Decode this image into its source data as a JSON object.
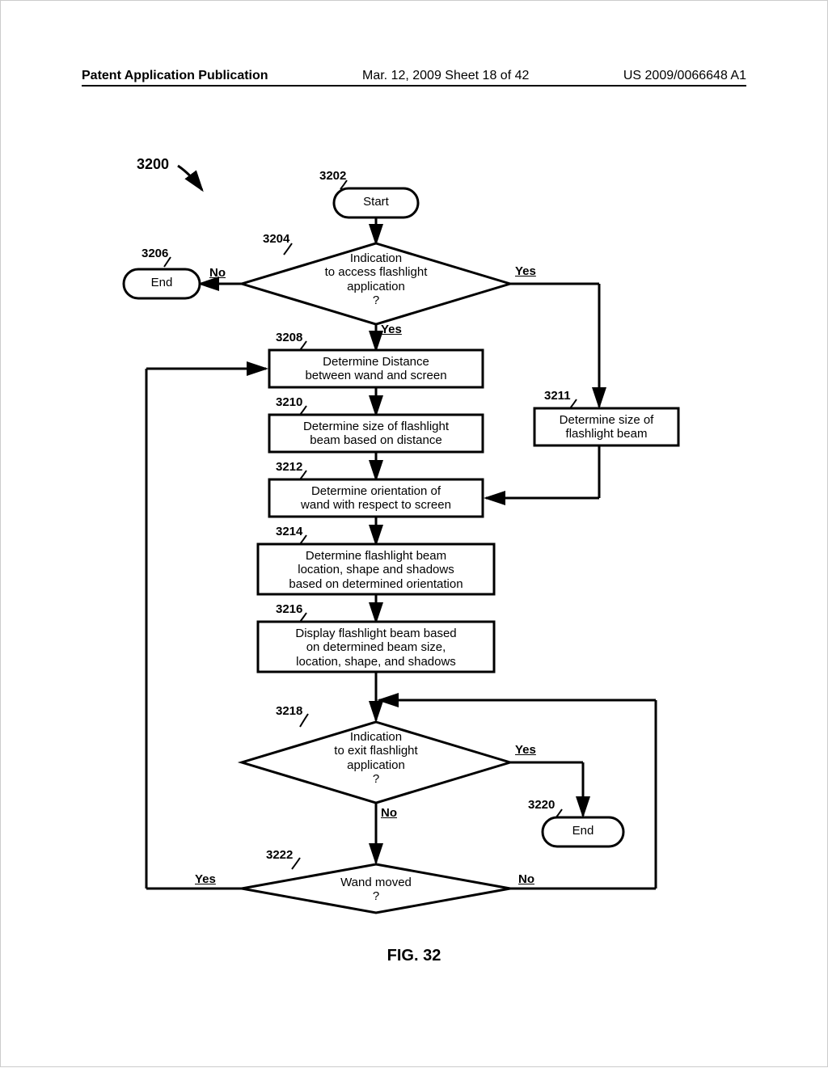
{
  "header": {
    "left": "Patent Application Publication",
    "middle": "Mar. 12, 2009  Sheet 18 of 42",
    "right": "US 2009/0066648 A1"
  },
  "figure": {
    "number_label": "3200",
    "title": "FIG. 32"
  },
  "labels": {
    "n3202": "3202",
    "n3204": "3204",
    "n3206": "3206",
    "n3208": "3208",
    "n3210": "3210",
    "n3211": "3211",
    "n3212": "3212",
    "n3214": "3214",
    "n3216": "3216",
    "n3218": "3218",
    "n3220": "3220",
    "n3222": "3222"
  },
  "nodes": {
    "start": "Start",
    "end_3206": "End",
    "end_3220": "End",
    "d3204": "Indication\nto access flashlight\napplication\n?",
    "p3208": "Determine Distance\nbetween wand and screen",
    "p3210": "Determine size of flashlight\nbeam based on distance",
    "p3211": "Determine size of\nflashlight beam",
    "p3212": "Determine orientation of\nwand with respect to screen",
    "p3214": "Determine flashlight beam\nlocation, shape and shadows\nbased on determined orientation",
    "p3216": "Display flashlight beam based\non determined beam size,\nlocation, shape, and shadows",
    "d3218": "Indication\nto exit flashlight\napplication\n?",
    "d3222": "Wand moved\n?"
  },
  "edges": {
    "no": "No",
    "yes": "Yes"
  }
}
